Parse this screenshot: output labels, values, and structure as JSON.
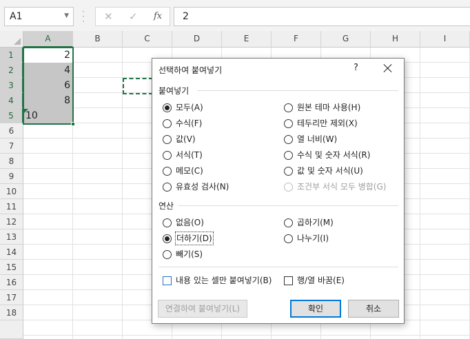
{
  "formula_bar": {
    "name_box": "A1",
    "cancel_glyph": "✕",
    "enter_glyph": "✓",
    "fx_label": "fx",
    "value": "2"
  },
  "sheet": {
    "columns": [
      "A",
      "B",
      "C",
      "D",
      "E",
      "F",
      "G",
      "H",
      "I"
    ],
    "rows": [
      "1",
      "2",
      "3",
      "4",
      "5",
      "6",
      "7",
      "8",
      "9",
      "10",
      "11",
      "12",
      "13",
      "14",
      "15",
      "16",
      "17",
      "18"
    ],
    "cells": [
      "2",
      "4",
      "6",
      "8",
      "10"
    ]
  },
  "dialog": {
    "title": "선택하여 붙여넣기",
    "help": "?",
    "paste_group": "붙여넣기",
    "paste_left": [
      "모두(A)",
      "수식(F)",
      "값(V)",
      "서식(T)",
      "메모(C)",
      "유효성 검사(N)"
    ],
    "paste_right": [
      "원본 테마 사용(H)",
      "테두리만 제외(X)",
      "열 너비(W)",
      "수식 및 숫자 서식(R)",
      "값 및 숫자 서식(U)",
      "조건부 서식 모두 병합(G)"
    ],
    "operation_group": "연산",
    "op_left": [
      "없음(O)",
      "더하기(D)",
      "빼기(S)"
    ],
    "op_right": [
      "곱하기(M)",
      "나누기(I)"
    ],
    "skip_blanks": "내용 있는 셀만 붙여넣기(B)",
    "transpose": "행/열 바꿈(E)",
    "paste_link": "연결하여 붙여넣기(L)",
    "ok": "확인",
    "cancel": "취소",
    "selected_paste": "모두(A)",
    "selected_operation": "더하기(D)"
  },
  "colors": {
    "accent": "#217346",
    "dialog_default_border": "#0078d7"
  },
  "icons": {
    "namebox_dropdown": "chevron-down-icon",
    "formula_options": "vertical-dots-icon",
    "dialog_close": "close-icon"
  }
}
